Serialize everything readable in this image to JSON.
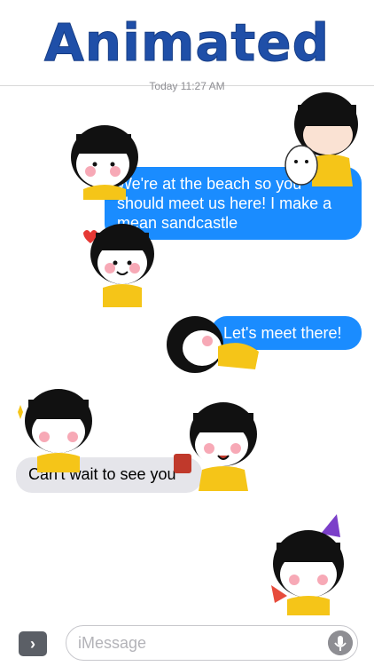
{
  "banner": {
    "title": "Animated"
  },
  "thread": {
    "timestamp": "Today 11:27 AM",
    "messages": [
      {
        "text": "We're at the beach so you should meet us here! I make a mean sandcastle",
        "direction": "outgoing"
      },
      {
        "text": "Let's meet there!",
        "direction": "outgoing"
      },
      {
        "text": "Can't wait to see you",
        "direction": "incoming"
      }
    ]
  },
  "composer": {
    "placeholder": "iMessage",
    "app_button_icon": "chevron-right-icon",
    "mic_icon": "microphone-icon"
  },
  "stickers": [
    "girl-thinking-sticker",
    "girl-hugging-cat-sticker",
    "girl-smiling-heart-sticker",
    "girl-lying-down-sticker",
    "girl-arms-crossed-sticker",
    "girl-drinking-sticker",
    "girl-party-hat-watermelon-sticker"
  ],
  "colors": {
    "outgoing_bubble": "#1a8cff",
    "incoming_bubble": "#e5e5ea",
    "banner_text": "#1f4fa8",
    "sticker_shirt": "#f5c518"
  }
}
